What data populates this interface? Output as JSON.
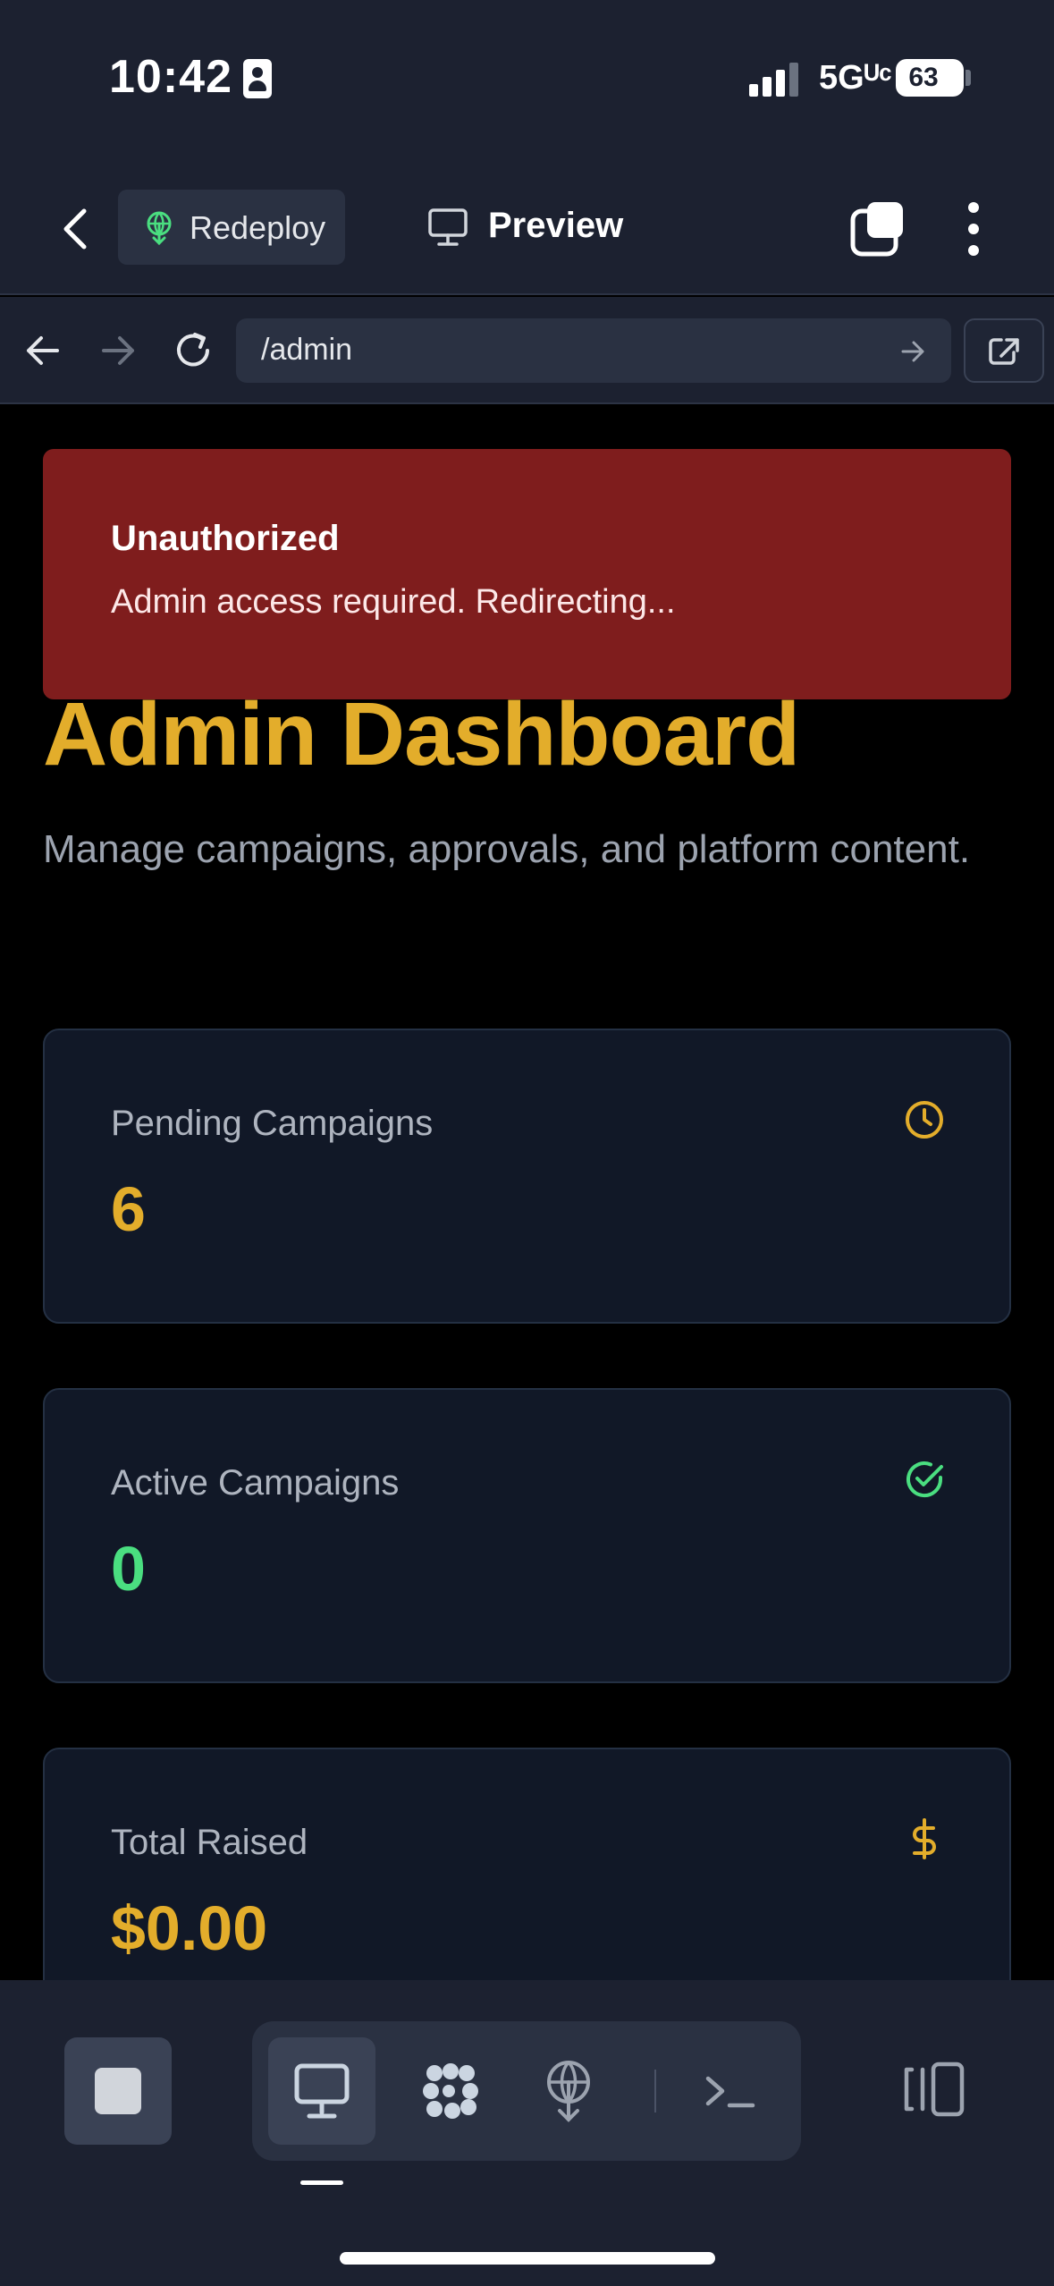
{
  "status_bar": {
    "time": "10:42",
    "network": "5Gᵁᶜ",
    "battery": "63"
  },
  "header": {
    "redeploy_label": "Redeploy",
    "preview_label": "Preview"
  },
  "browser": {
    "url": "/admin"
  },
  "toast": {
    "title": "Unauthorized",
    "message": "Admin access required. Redirecting..."
  },
  "page": {
    "title": "Admin Dashboard",
    "subtitle": "Manage campaigns, approvals, and platform content."
  },
  "stats": [
    {
      "label": "Pending Campaigns",
      "value": "6",
      "icon": "clock-icon",
      "color": "#e3ad2b"
    },
    {
      "label": "Active Campaigns",
      "value": "0",
      "icon": "check-circle-icon",
      "color": "#4ade80"
    },
    {
      "label": "Total Raised",
      "value": "$0.00",
      "icon": "dollar-icon",
      "color": "#e3ad2b"
    }
  ],
  "colors": {
    "accent": "#e3ad2b",
    "success": "#4ade80",
    "danger_toast": "#7f1d1d",
    "chrome": "#1c2130"
  }
}
